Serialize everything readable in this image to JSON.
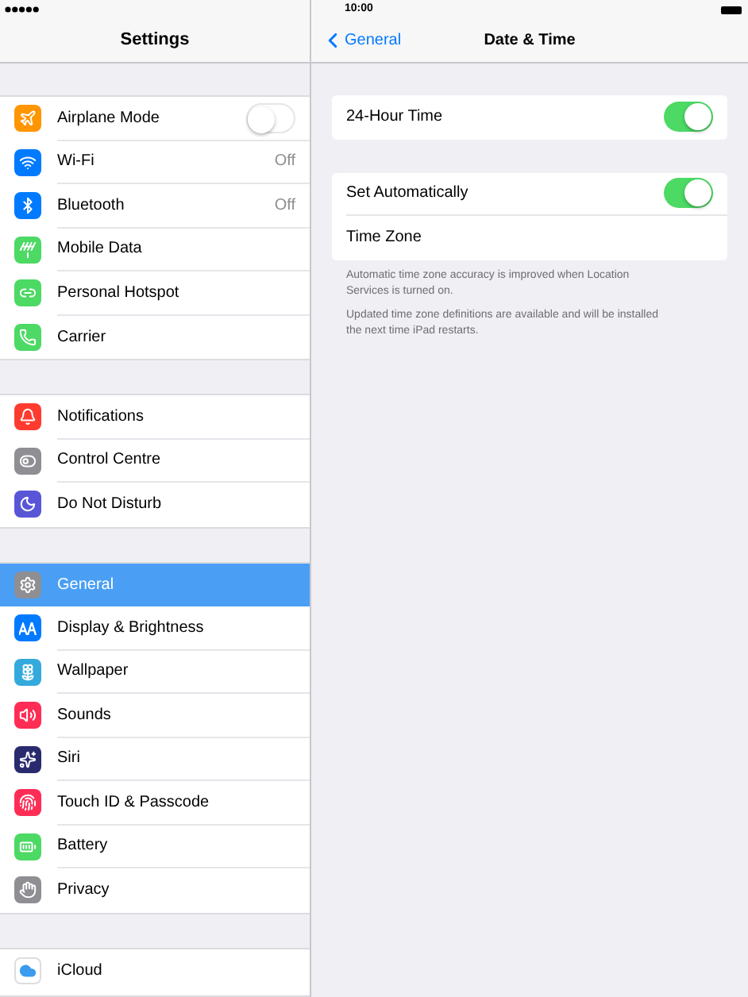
{
  "status_bar": {
    "time": "10:00"
  },
  "sidebar": {
    "title": "Settings",
    "groups": [
      [
        {
          "label": "Airplane Mode",
          "kind": "airplane",
          "on": false,
          "selected": false
        },
        {
          "label": "Wi-Fi",
          "kind": "wifi",
          "value": "Off",
          "selected": false
        },
        {
          "label": "Bluetooth",
          "kind": "bluetooth",
          "value": "Off",
          "selected": false
        },
        {
          "label": "Mobile Data",
          "kind": "antenna",
          "selected": false
        },
        {
          "label": "Personal Hotspot",
          "kind": "hotspot",
          "selected": false
        },
        {
          "label": "Carrier",
          "kind": "phone",
          "selected": false
        }
      ],
      [
        {
          "label": "Notifications",
          "kind": "notifications",
          "selected": false
        },
        {
          "label": "Control Centre",
          "kind": "control",
          "selected": false
        },
        {
          "label": "Do Not Disturb",
          "kind": "moon",
          "selected": false
        }
      ],
      [
        {
          "label": "General",
          "kind": "gear",
          "selected": true
        },
        {
          "label": "Display & Brightness",
          "kind": "display",
          "selected": false
        },
        {
          "label": "Wallpaper",
          "kind": "flower",
          "selected": false
        },
        {
          "label": "Sounds",
          "kind": "sound",
          "selected": false
        },
        {
          "label": "Siri",
          "kind": "siri",
          "selected": false
        },
        {
          "label": "Touch ID & Passcode",
          "kind": "fingerprint",
          "selected": false
        },
        {
          "label": "Battery",
          "kind": "battery",
          "selected": false
        },
        {
          "label": "Privacy",
          "kind": "hand",
          "selected": false
        }
      ],
      [
        {
          "label": "iCloud",
          "kind": "cloud",
          "selected": false
        }
      ]
    ]
  },
  "detail": {
    "back": "General",
    "title": "Date & Time",
    "groups": [
      {
        "rows": [
          {
            "label": "24-Hour Time",
            "kind": "toggle",
            "on": true
          }
        ]
      },
      {
        "rows": [
          {
            "label": "Set Automatically",
            "kind": "toggle",
            "on": true
          },
          {
            "label": "Time Zone",
            "kind": "plain"
          }
        ],
        "notes": [
          "Automatic time zone accuracy is improved when Location Services is turned on.",
          "Updated time zone definitions are available and will be installed the next time iPad restarts."
        ]
      }
    ]
  }
}
